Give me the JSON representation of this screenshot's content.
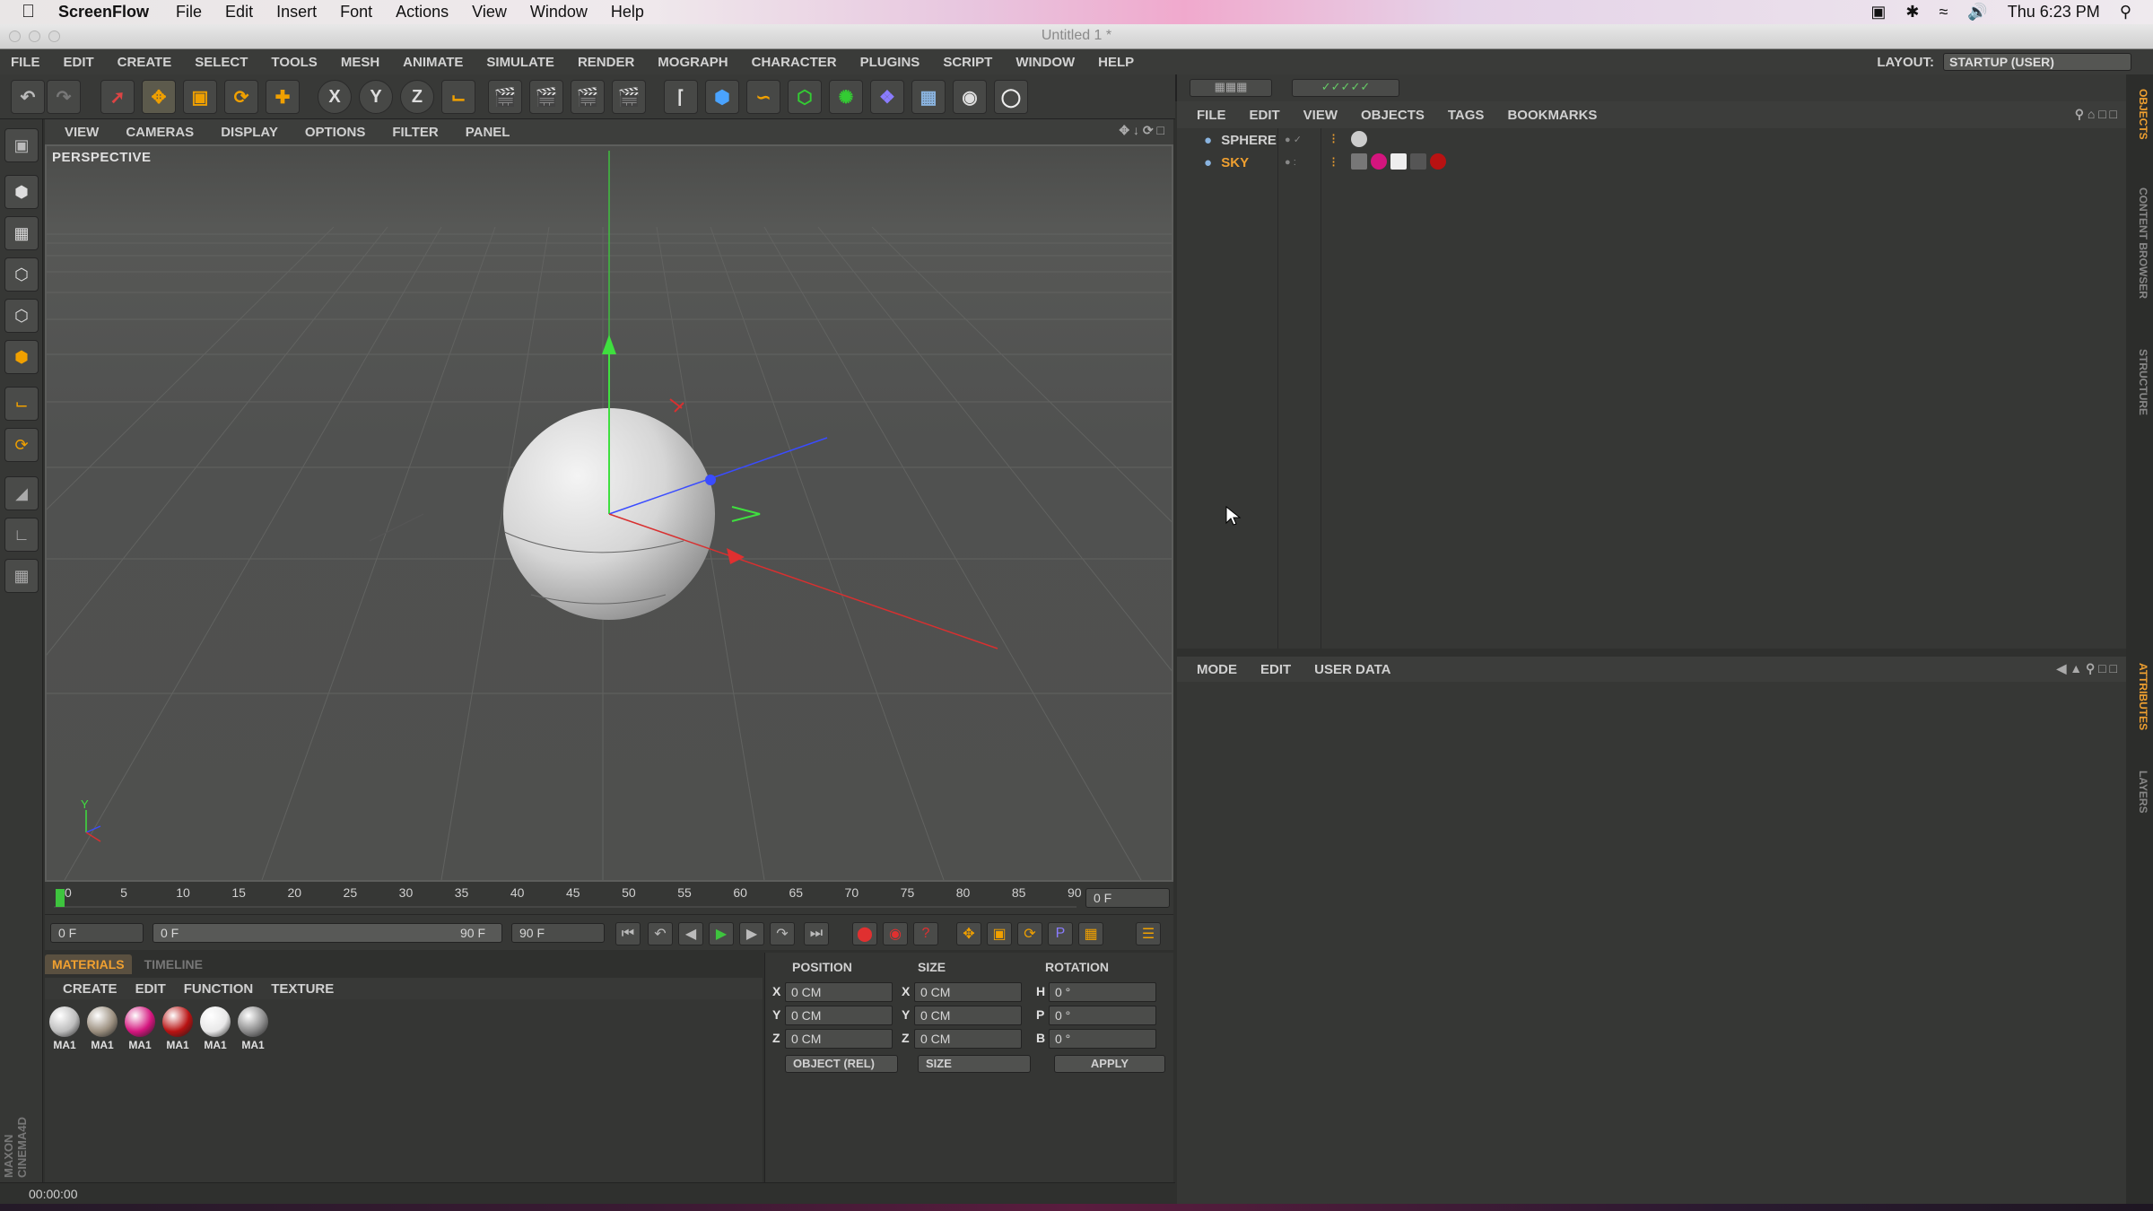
{
  "mac_menu": {
    "app_name": "ScreenFlow",
    "items": [
      "File",
      "Edit",
      "Insert",
      "Font",
      "Actions",
      "View",
      "Window",
      "Help"
    ],
    "clock": "Thu 6:23 PM"
  },
  "window_title": "Untitled 1 *",
  "c4d_menu": {
    "items": [
      "FILE",
      "EDIT",
      "CREATE",
      "SELECT",
      "TOOLS",
      "MESH",
      "ANIMATE",
      "SIMULATE",
      "RENDER",
      "MOGRAPH",
      "CHARACTER",
      "PLUGINS",
      "SCRIPT",
      "WINDOW",
      "HELP"
    ],
    "layout_label": "LAYOUT:",
    "layout_value": "STARTUP (USER)"
  },
  "toolbar": {
    "x_label": "X",
    "y_label": "Y",
    "z_label": "Z"
  },
  "viewport": {
    "menu": [
      "VIEW",
      "CAMERAS",
      "DISPLAY",
      "OPTIONS",
      "FILTER",
      "PANEL"
    ],
    "label": "PERSPECTIVE"
  },
  "timeline": {
    "ticks": [
      "0",
      "5",
      "10",
      "15",
      "20",
      "25",
      "30",
      "35",
      "40",
      "45",
      "50",
      "55",
      "60",
      "65",
      "70",
      "75",
      "80",
      "85",
      "90"
    ],
    "current_frame": "0 F",
    "start_field": "0 F",
    "range_start": "0 F",
    "range_end": "90 F",
    "end_field": "90 F"
  },
  "materials": {
    "tabs": [
      "MATERIALS",
      "TIMELINE"
    ],
    "menu": [
      "CREATE",
      "EDIT",
      "FUNCTION",
      "TEXTURE"
    ],
    "items": [
      {
        "label": "MA1",
        "color": "#bdbdbd"
      },
      {
        "label": "MA1",
        "color": "#9b8f7f"
      },
      {
        "label": "MA1",
        "color": "#d4157e"
      },
      {
        "label": "MA1",
        "color": "#b81212"
      },
      {
        "label": "MA1",
        "color": "#e8e8e8"
      },
      {
        "label": "MA1",
        "color": "#8a8a8a"
      }
    ]
  },
  "coords": {
    "headers": {
      "position": "POSITION",
      "size": "SIZE",
      "rotation": "ROTATION"
    },
    "rows": [
      {
        "axis": "X",
        "pos": "0 CM",
        "size_axis": "X",
        "size": "0 CM",
        "rot_axis": "H",
        "rot": "0 °"
      },
      {
        "axis": "Y",
        "pos": "0 CM",
        "size_axis": "Y",
        "size": "0 CM",
        "rot_axis": "P",
        "rot": "0 °"
      },
      {
        "axis": "Z",
        "pos": "0 CM",
        "size_axis": "Z",
        "size": "0 CM",
        "rot_axis": "B",
        "rot": "0 °"
      }
    ],
    "object_mode": "OBJECT (REL)",
    "size_mode": "SIZE",
    "apply": "APPLY"
  },
  "status_time": "00:00:00",
  "objects": {
    "menu": [
      "FILE",
      "EDIT",
      "VIEW",
      "OBJECTS",
      "TAGS",
      "BOOKMARKS"
    ],
    "items": [
      {
        "name": "SPHERE",
        "color": "#d0d0d0"
      },
      {
        "name": "SKY",
        "color": "#f0a030"
      }
    ]
  },
  "attributes": {
    "menu": [
      "MODE",
      "EDIT",
      "USER DATA"
    ]
  },
  "side_tabs": [
    "OBJECTS",
    "CONTENT BROWSER",
    "STRUCTURE",
    "ATTRIBUTES",
    "LAYERS"
  ],
  "brand": "MAXON CINEMA4D"
}
